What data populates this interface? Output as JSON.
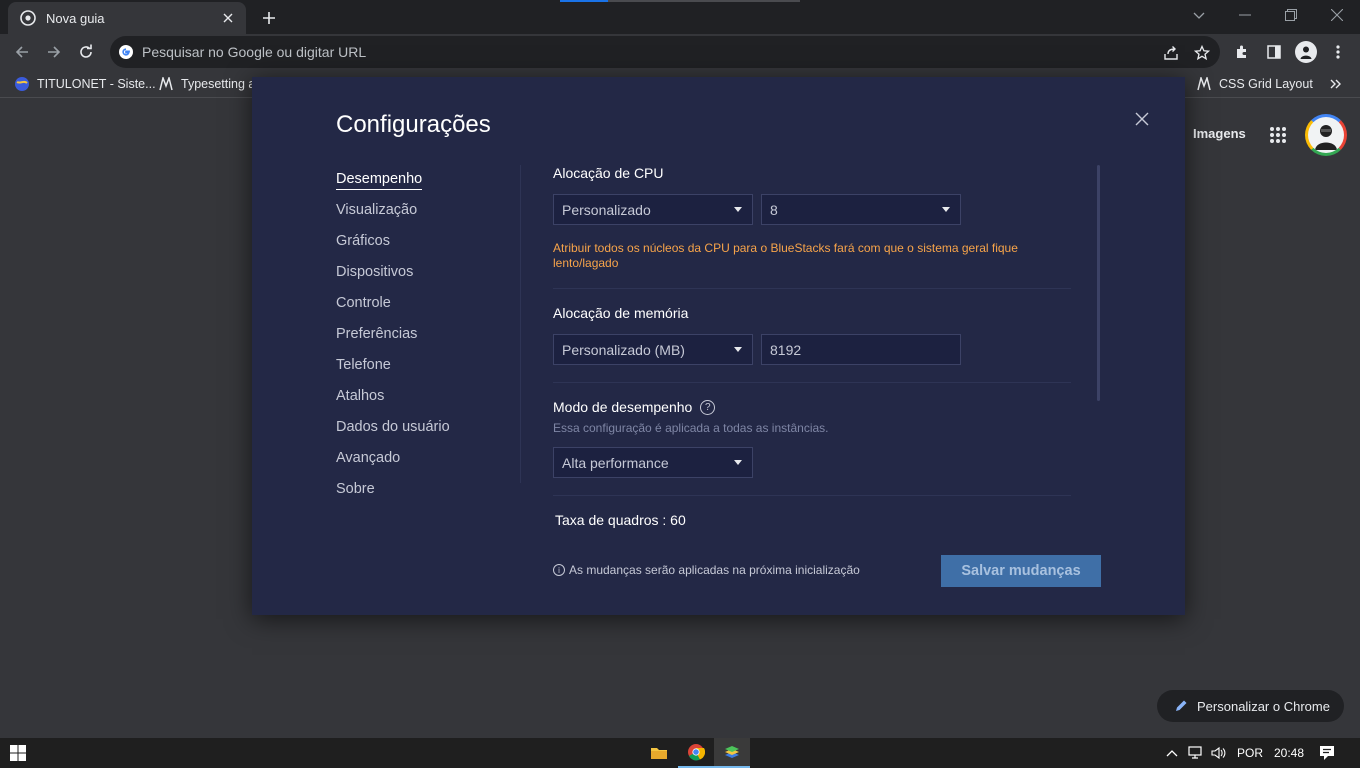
{
  "browser": {
    "tab_title": "Nova guia",
    "omnibox_placeholder": "Pesquisar no Google ou digitar URL",
    "bookmarks": [
      {
        "label": "TITULONET - Siste..."
      },
      {
        "label": "Typesetting a"
      },
      {
        "label": "CSS Grid Layout"
      }
    ]
  },
  "page": {
    "images_link": "Imagens",
    "customize_label": "Personalizar o Chrome"
  },
  "settings": {
    "title": "Configurações",
    "nav": [
      {
        "label": "Desempenho",
        "active": true
      },
      {
        "label": "Visualização"
      },
      {
        "label": "Gráficos"
      },
      {
        "label": "Dispositivos"
      },
      {
        "label": "Controle"
      },
      {
        "label": "Preferências"
      },
      {
        "label": "Telefone"
      },
      {
        "label": "Atalhos"
      },
      {
        "label": "Dados do usuário"
      },
      {
        "label": "Avançado"
      },
      {
        "label": "Sobre"
      }
    ],
    "cpu": {
      "label": "Alocação de CPU",
      "mode": "Personalizado",
      "cores": "8",
      "warning": "Atribuir todos os núcleos da CPU para o BlueStacks fará com que o sistema geral fique lento/lagado"
    },
    "memory": {
      "label": "Alocação de memória",
      "mode": "Personalizado (MB)",
      "value": "8192"
    },
    "performance": {
      "label": "Modo de desempenho",
      "help": "?",
      "hint": "Essa configuração é aplicada a todas as instâncias.",
      "mode": "Alta performance"
    },
    "framerate": {
      "label": "Taxa de quadros : 60"
    },
    "footer_note": "As mudanças serão aplicadas na próxima inicialização",
    "info_glyph": "i",
    "save_label": "Salvar mudanças"
  },
  "taskbar": {
    "language": "POR",
    "time": "20:48"
  },
  "colors": {
    "modal_bg": "#232846",
    "warning": "#f7a44a",
    "save_button": "#3f6fa7"
  }
}
